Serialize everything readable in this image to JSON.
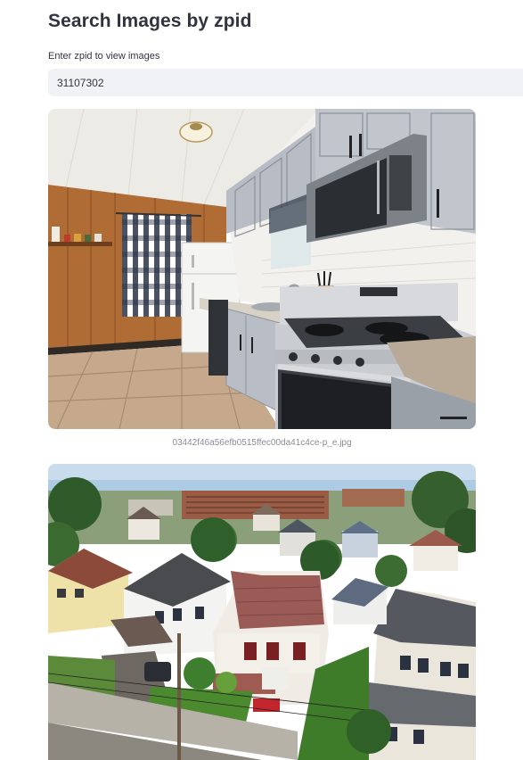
{
  "page": {
    "title": "Search Images by zpid"
  },
  "search": {
    "label": "Enter zpid to view images",
    "value": "31107302"
  },
  "images": [
    {
      "caption": "03442f46a56efb0515ffec00da41c4ce-p_e.jpg",
      "subject": "kitchen"
    },
    {
      "caption": "",
      "subject": "neighborhood-aerial"
    }
  ]
}
